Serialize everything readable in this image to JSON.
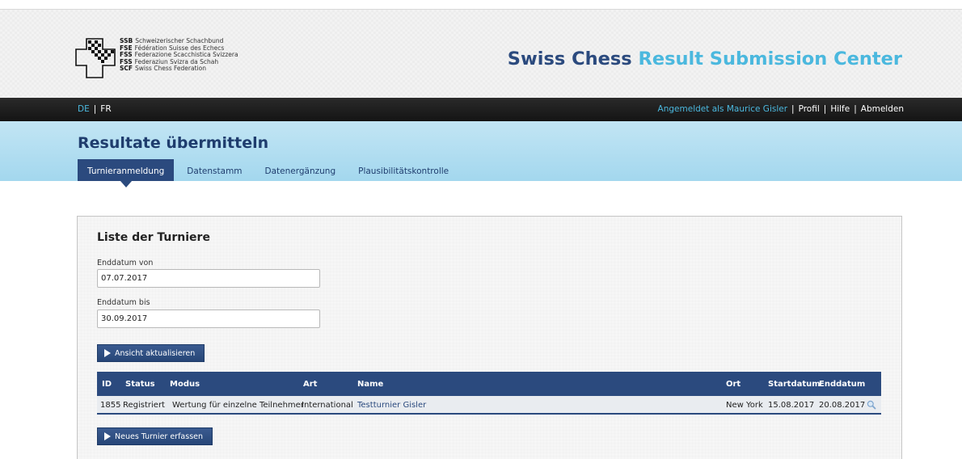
{
  "header": {
    "logo_lines": [
      {
        "abbr": "SSB",
        "name": "Schweizerischer Schachbund"
      },
      {
        "abbr": "FSE",
        "name": "Fédération Suisse des Echecs"
      },
      {
        "abbr": "FSS",
        "name": "Federazione Scacchistica Svizzera"
      },
      {
        "abbr": "FSS",
        "name": "Federaziun Svizra da Schah"
      },
      {
        "abbr": "SCF",
        "name": "Swiss Chess Federation"
      }
    ],
    "title_part1": "Swiss Chess",
    "title_part2": "Result Submission Center"
  },
  "topbar": {
    "languages": [
      "DE",
      "FR"
    ],
    "active_language": "DE",
    "separator": "|",
    "logged_in": "Angemeldet als Maurice Gisler",
    "profile": "Profil",
    "help": "Hilfe",
    "logout": "Abmelden"
  },
  "section": {
    "title": "Resultate übermitteln",
    "tabs": [
      "Turnieranmeldung",
      "Datenstamm",
      "Datenergänzung",
      "Plausibilitätskontrolle"
    ],
    "active_tab": "Turnieranmeldung"
  },
  "panel": {
    "title": "Liste der Turniere",
    "end_from_label": "Enddatum von",
    "end_from_value": "07.07.2017",
    "end_to_label": "Enddatum bis",
    "end_to_value": "30.09.2017",
    "refresh_button": "Ansicht aktualisieren",
    "new_button": "Neues Turnier erfassen"
  },
  "table": {
    "columns": [
      "ID",
      "Status",
      "Modus",
      "Art",
      "Name",
      "Ort",
      "Startdatum",
      "Enddatum"
    ],
    "rows": [
      [
        "1855",
        "Registriert",
        "Wertung für einzelne Teilnehmer",
        "International",
        "Testturnier Gisler",
        "New York",
        "15.08.2017",
        "20.08.2017"
      ]
    ]
  },
  "colors": {
    "navy": "#2b4a7e",
    "accent": "#4bb8de",
    "band": "#a3d7ee",
    "topbar": "#1a1a1a"
  },
  "icons": {
    "logo": "swiss-chess-logo-icon",
    "play": "play-icon",
    "detail": "magnifier-icon"
  }
}
